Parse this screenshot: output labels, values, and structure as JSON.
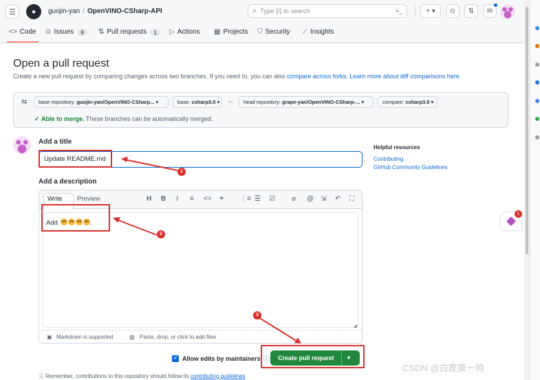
{
  "header": {
    "owner": "guojin-yan",
    "separator": "/",
    "repo": "OpenVINO-CSharp-API",
    "search_placeholder": "Type [/] to search",
    "search_shortcut": ">_",
    "plus_label": "+ ▾"
  },
  "tabs": [
    {
      "label": "Code",
      "icon": "code-icon"
    },
    {
      "label": "Issues",
      "icon": "issue-icon",
      "count": "9"
    },
    {
      "label": "Pull requests",
      "icon": "pull-request-icon",
      "count": "1"
    },
    {
      "label": "Actions",
      "icon": "play-icon"
    },
    {
      "label": "Projects",
      "icon": "table-icon"
    },
    {
      "label": "Security",
      "icon": "shield-icon"
    },
    {
      "label": "Insights",
      "icon": "graph-icon"
    }
  ],
  "page": {
    "title": "Open a pull request",
    "subtitle": "Create a new pull request by comparing changes across two branches. If you need to, you can also",
    "compare_forks_link": "compare across forks.",
    "learn_more_link": "Learn more about diff comparisons here."
  },
  "compare": {
    "base_repo_label": "base repository:",
    "base_repo_value": "guojin-yan/OpenVINO-CSharp...",
    "base_label": "base:",
    "base_value": "csharp3.0",
    "head_repo_label": "head repository:",
    "head_repo_value": "grape-yan/OpenVINO-CSharp-...",
    "compare_label": "compare:",
    "compare_value": "csharp3.0",
    "merge_status": "Able to merge.",
    "merge_note": "These branches can be automatically merged."
  },
  "form": {
    "title_label": "Add a title",
    "title_value": "Update README.md",
    "description_label": "Add a description",
    "write_tab": "Write",
    "preview_tab": "Preview",
    "description_value": "Add",
    "markdown_note": "Markdown is supported",
    "paste_note": "Paste, drop, or click to add files",
    "allow_edits_label": "Allow edits by maintainers",
    "create_button": "Create pull request",
    "remember_text": "Remember, contributions to this repository should follow its",
    "remember_link": "contributing guidelines"
  },
  "helpful": {
    "heading": "Helpful resources",
    "links": [
      "Contributing",
      "GitHub Community Guidelines"
    ]
  },
  "annotations": {
    "step1": "1",
    "step2": "2",
    "step3": "3",
    "color": "#d9302c"
  },
  "extension_badge": "1",
  "watermark": "CSDN @白鹿第一帅"
}
